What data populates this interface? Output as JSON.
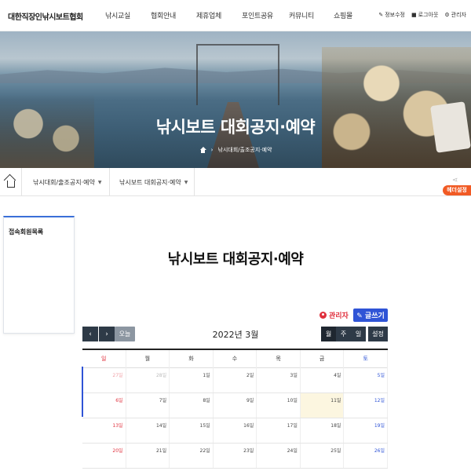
{
  "header": {
    "logo": "대한직장인낚시보트협회",
    "nav": [
      "낚시교실",
      "협회안내",
      "제휴업체",
      "포인트공유",
      "커뮤니티",
      "쇼핑몰"
    ],
    "util": [
      {
        "icon": "wrench-icon",
        "glyph": "✎",
        "label": "정보수정"
      },
      {
        "icon": "lock-icon",
        "glyph": "■",
        "label": "로그아웃"
      },
      {
        "icon": "gear-icon",
        "glyph": "⚙",
        "label": "관리자"
      }
    ]
  },
  "hero": {
    "title": "낚시보트 대회공지·예약",
    "crumb_sep": "›",
    "crumb": "낚시대회/출조공지·예약"
  },
  "subnav": {
    "item1": "낚시대회/출조공지·예약",
    "item2": "낚시보트 대회공지·예약",
    "caret": "▼",
    "share_glyph": "⋖",
    "help": "헤더설정"
  },
  "sidebar": {
    "title": "접속회원목록"
  },
  "main": {
    "title": "낚시보트 대회공지·예약",
    "admin_label": "관리자",
    "write_label": "✎ 글쓰기",
    "prev": "‹",
    "next": "›",
    "today": "오늘",
    "month": "2022년 3월",
    "views": [
      "월",
      "주",
      "일"
    ],
    "setting": "설정"
  },
  "calendar": {
    "weekdays": [
      "일",
      "월",
      "화",
      "수",
      "목",
      "금",
      "토"
    ],
    "rows": [
      [
        "27일",
        "28일",
        "1일",
        "2일",
        "3일",
        "4일",
        "5일"
      ],
      [
        "6일",
        "7일",
        "8일",
        "9일",
        "10일",
        "11일",
        "12일"
      ],
      [
        "13일",
        "14일",
        "15일",
        "16일",
        "17일",
        "18일",
        "19일"
      ],
      [
        "20일",
        "21일",
        "22일",
        "23일",
        "24일",
        "25일",
        "26일"
      ]
    ],
    "today": "11일"
  },
  "colors": {
    "accent": "#2f54d6",
    "danger": "#e0303d",
    "dark_button": "#2e3a47",
    "help_orange": "#f15a24"
  }
}
